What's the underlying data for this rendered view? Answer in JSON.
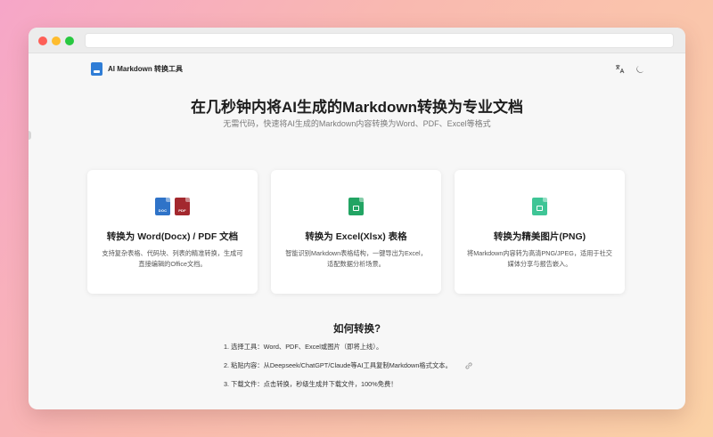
{
  "app": {
    "brand": "AI Markdown 转换工具"
  },
  "hero": {
    "title": "在几秒钟内将AI生成的Markdown转换为专业文档",
    "subtitle": "无需代码，快速将AI生成的Markdown内容转换为Word、PDF、Excel等格式"
  },
  "cards": [
    {
      "title": "转换为 Word(Docx) / PDF 文档",
      "description": "支持复杂表格、代码块、列表的精准转换，生成可直接编辑的Office文档。",
      "icons": [
        {
          "name": "docx-file-icon",
          "tag": "DOC",
          "color": "#2f73c8"
        },
        {
          "name": "pdf-file-icon",
          "tag": "PDF",
          "color": "#a3282e"
        }
      ]
    },
    {
      "title": "转换为 Excel(Xlsx) 表格",
      "description": "智能识别Markdown表格结构，一键导出为Excel，适配数据分析场景。",
      "icons": [
        {
          "name": "excel-file-icon",
          "tag": "",
          "color": "#22a463"
        }
      ]
    },
    {
      "title": "转换为精美图片(PNG)",
      "description": "将Markdown内容转为高清PNG/JPEG，适用于社交媒体分享与报告嵌入。",
      "icons": [
        {
          "name": "image-file-icon",
          "tag": "",
          "color": "#3fc596"
        }
      ]
    }
  ],
  "how": {
    "title": "如何转换?",
    "steps": [
      "1. 选择工具：Word、PDF、Excel或图片（即将上线）。",
      "2. 粘贴内容：从Deepseek/ChatGPT/Claude等AI工具复制Markdown格式文本。",
      "3. 下载文件：点击转换，秒级生成并下载文件，100%免费！"
    ]
  },
  "topbar_icons": [
    "translate-icon",
    "moon-icon"
  ]
}
